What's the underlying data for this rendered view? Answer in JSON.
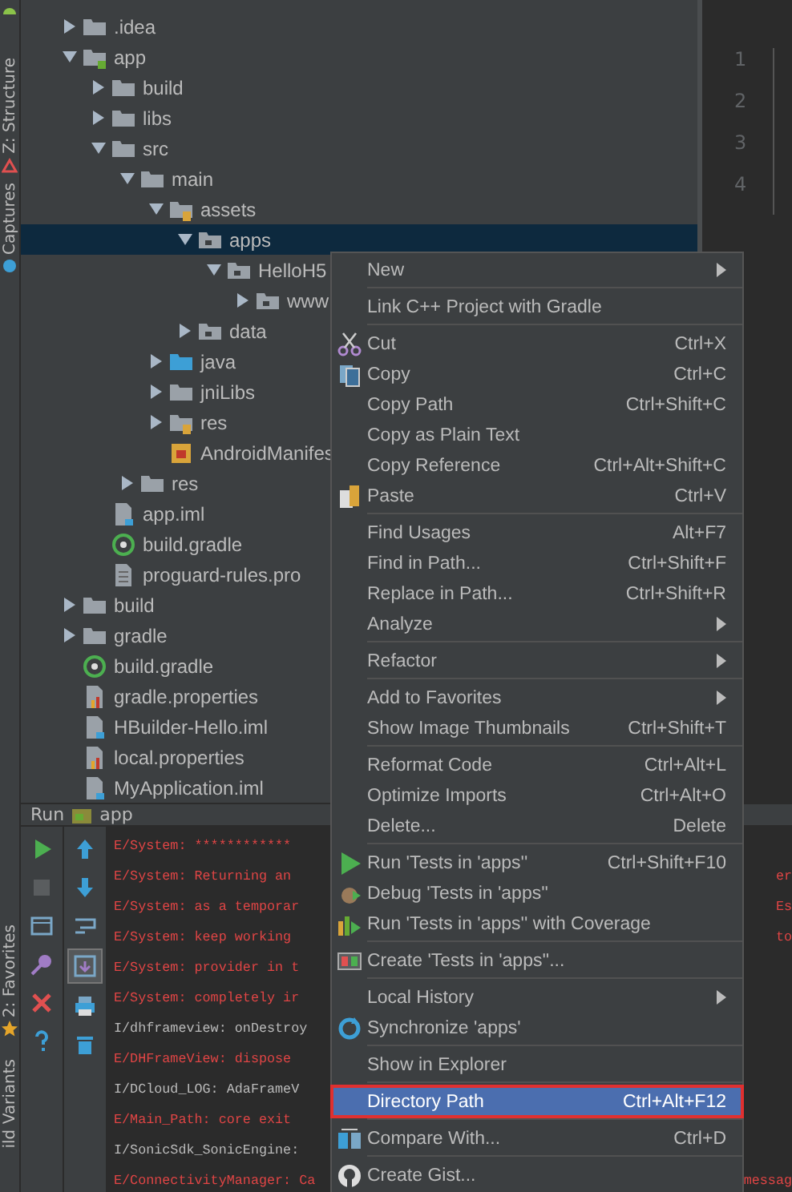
{
  "side_tabs": [
    {
      "label": "Z: Structure"
    },
    {
      "label": "Captures"
    },
    {
      "label": "2: Favorites"
    },
    {
      "label": "ild Variants"
    }
  ],
  "tree": [
    {
      "name": ".idea",
      "kind": "folder",
      "expanded": false,
      "selected": false
    },
    {
      "name": "app",
      "kind": "module",
      "expanded": true,
      "selected": false,
      "children": [
        {
          "name": "build",
          "kind": "folder",
          "expanded": false,
          "selected": false
        },
        {
          "name": "libs",
          "kind": "folder",
          "expanded": false,
          "selected": false
        },
        {
          "name": "src",
          "kind": "folder",
          "expanded": true,
          "selected": false,
          "children": [
            {
              "name": "main",
              "kind": "folder",
              "expanded": true,
              "selected": false,
              "children": [
                {
                  "name": "assets",
                  "kind": "resources",
                  "expanded": true,
                  "selected": false,
                  "children": [
                    {
                      "name": "apps",
                      "kind": "package",
                      "expanded": true,
                      "selected": true,
                      "children": [
                        {
                          "name": "HelloH5",
                          "kind": "package",
                          "expanded": true,
                          "selected": false,
                          "children": [
                            {
                              "name": "www",
                              "kind": "package",
                              "expanded": false,
                              "selected": false
                            }
                          ]
                        }
                      ]
                    },
                    {
                      "name": "data",
                      "kind": "package",
                      "expanded": false,
                      "selected": false
                    }
                  ]
                },
                {
                  "name": "java",
                  "kind": "sources",
                  "expanded": false,
                  "selected": false
                },
                {
                  "name": "jniLibs",
                  "kind": "folder",
                  "expanded": false,
                  "selected": false
                },
                {
                  "name": "res",
                  "kind": "resources",
                  "expanded": false,
                  "selected": false
                },
                {
                  "name": "AndroidManifes",
                  "kind": "manifest",
                  "selected": false
                }
              ]
            },
            {
              "name": "res",
              "kind": "folder",
              "expanded": false,
              "selected": false
            }
          ]
        },
        {
          "name": "app.iml",
          "kind": "iml",
          "selected": false
        },
        {
          "name": "build.gradle",
          "kind": "gradle",
          "selected": false
        },
        {
          "name": "proguard-rules.pro",
          "kind": "text",
          "selected": false
        }
      ]
    },
    {
      "name": "build",
      "kind": "folder",
      "expanded": false,
      "selected": false
    },
    {
      "name": "gradle",
      "kind": "folder",
      "expanded": false,
      "selected": false
    },
    {
      "name": "build.gradle",
      "kind": "gradle",
      "selected": false
    },
    {
      "name": "gradle.properties",
      "kind": "properties",
      "selected": false
    },
    {
      "name": "HBuilder-Hello.iml",
      "kind": "iml",
      "selected": false
    },
    {
      "name": "local.properties",
      "kind": "properties",
      "selected": false
    },
    {
      "name": "MyApplication.iml",
      "kind": "iml",
      "selected": false
    }
  ],
  "editor": {
    "line_numbers": [
      "1",
      "2",
      "3",
      "4"
    ]
  },
  "run_bar": {
    "label": "Run",
    "config": "app"
  },
  "run_tools_left": [
    {
      "selected": false
    },
    {
      "selected": false
    },
    {
      "selected": false
    },
    {
      "selected": false
    },
    {
      "selected": false
    },
    {
      "selected": false
    }
  ],
  "run_tools_right": [
    {
      "selected": false
    },
    {
      "selected": false
    },
    {
      "selected": false
    },
    {
      "selected": true
    },
    {
      "selected": false
    },
    {
      "selected": false
    }
  ],
  "console": [
    {
      "kind": "error",
      "text": "E/System: ************"
    },
    {
      "kind": "error",
      "text": "E/System: Returning an",
      "right": "er"
    },
    {
      "kind": "error",
      "text": "E/System: as a temporar",
      "right": "Es"
    },
    {
      "kind": "error",
      "text": "E/System: keep working",
      "right": "to"
    },
    {
      "kind": "error",
      "text": "E/System: provider in t"
    },
    {
      "kind": "error",
      "text": "E/System: completely ir"
    },
    {
      "kind": "info",
      "text": "I/dhframeview: onDestroy"
    },
    {
      "kind": "error",
      "text": "E/DHFrameView: dispose"
    },
    {
      "kind": "info",
      "text": "I/DCloud_LOG: AdaFrameV"
    },
    {
      "kind": "error",
      "text": "E/Main_Path: core exit"
    },
    {
      "kind": "info",
      "text": "I/SonicSdk_SonicEngine:"
    },
    {
      "kind": "error",
      "text": "E/ConnectivityManager: Ca",
      "right": "messag"
    }
  ],
  "context_menu": [
    {
      "kind": "item",
      "label": "New",
      "submenu": true,
      "selected": false
    },
    {
      "kind": "separator"
    },
    {
      "kind": "item",
      "label": "Link C++ Project with Gradle",
      "selected": false
    },
    {
      "kind": "separator"
    },
    {
      "kind": "item",
      "label": "Cut",
      "shortcut": "Ctrl+X",
      "selected": false
    },
    {
      "kind": "item",
      "label": "Copy",
      "shortcut": "Ctrl+C",
      "selected": false
    },
    {
      "kind": "item",
      "label": "Copy Path",
      "shortcut": "Ctrl+Shift+C",
      "selected": false
    },
    {
      "kind": "item",
      "label": "Copy as Plain Text",
      "selected": false
    },
    {
      "kind": "item",
      "label": "Copy Reference",
      "shortcut": "Ctrl+Alt+Shift+C",
      "selected": false
    },
    {
      "kind": "item",
      "label": "Paste",
      "shortcut": "Ctrl+V",
      "selected": false
    },
    {
      "kind": "separator"
    },
    {
      "kind": "item",
      "label": "Find Usages",
      "shortcut": "Alt+F7",
      "selected": false
    },
    {
      "kind": "item",
      "label": "Find in Path...",
      "shortcut": "Ctrl+Shift+F",
      "selected": false
    },
    {
      "kind": "item",
      "label": "Replace in Path...",
      "shortcut": "Ctrl+Shift+R",
      "selected": false
    },
    {
      "kind": "item",
      "label": "Analyze",
      "submenu": true,
      "selected": false
    },
    {
      "kind": "separator"
    },
    {
      "kind": "item",
      "label": "Refactor",
      "submenu": true,
      "selected": false
    },
    {
      "kind": "separator"
    },
    {
      "kind": "item",
      "label": "Add to Favorites",
      "submenu": true,
      "selected": false
    },
    {
      "kind": "item",
      "label": "Show Image Thumbnails",
      "shortcut": "Ctrl+Shift+T",
      "selected": false
    },
    {
      "kind": "separator"
    },
    {
      "kind": "item",
      "label": "Reformat Code",
      "shortcut": "Ctrl+Alt+L",
      "selected": false
    },
    {
      "kind": "item",
      "label": "Optimize Imports",
      "shortcut": "Ctrl+Alt+O",
      "selected": false
    },
    {
      "kind": "item",
      "label": "Delete...",
      "shortcut": "Delete",
      "selected": false
    },
    {
      "kind": "separator"
    },
    {
      "kind": "item",
      "label": "Run 'Tests in 'apps''",
      "shortcut": "Ctrl+Shift+F10",
      "selected": false
    },
    {
      "kind": "item",
      "label": "Debug 'Tests in 'apps''",
      "selected": false
    },
    {
      "kind": "item",
      "label": "Run 'Tests in 'apps'' with Coverage",
      "selected": false
    },
    {
      "kind": "separator"
    },
    {
      "kind": "item",
      "label": "Create 'Tests in 'apps''...",
      "selected": false
    },
    {
      "kind": "separator"
    },
    {
      "kind": "item",
      "label": "Local History",
      "submenu": true,
      "selected": false
    },
    {
      "kind": "item",
      "label": "Synchronize 'apps'",
      "selected": false
    },
    {
      "kind": "separator"
    },
    {
      "kind": "item",
      "label": "Show in Explorer",
      "selected": false
    },
    {
      "kind": "separator"
    },
    {
      "kind": "item",
      "label": "Directory Path",
      "shortcut": "Ctrl+Alt+F12",
      "selected": true
    },
    {
      "kind": "separator"
    },
    {
      "kind": "item",
      "label": "Compare With...",
      "shortcut": "Ctrl+D",
      "selected": false
    },
    {
      "kind": "separator"
    },
    {
      "kind": "item",
      "label": "Create Gist...",
      "selected": false
    }
  ]
}
